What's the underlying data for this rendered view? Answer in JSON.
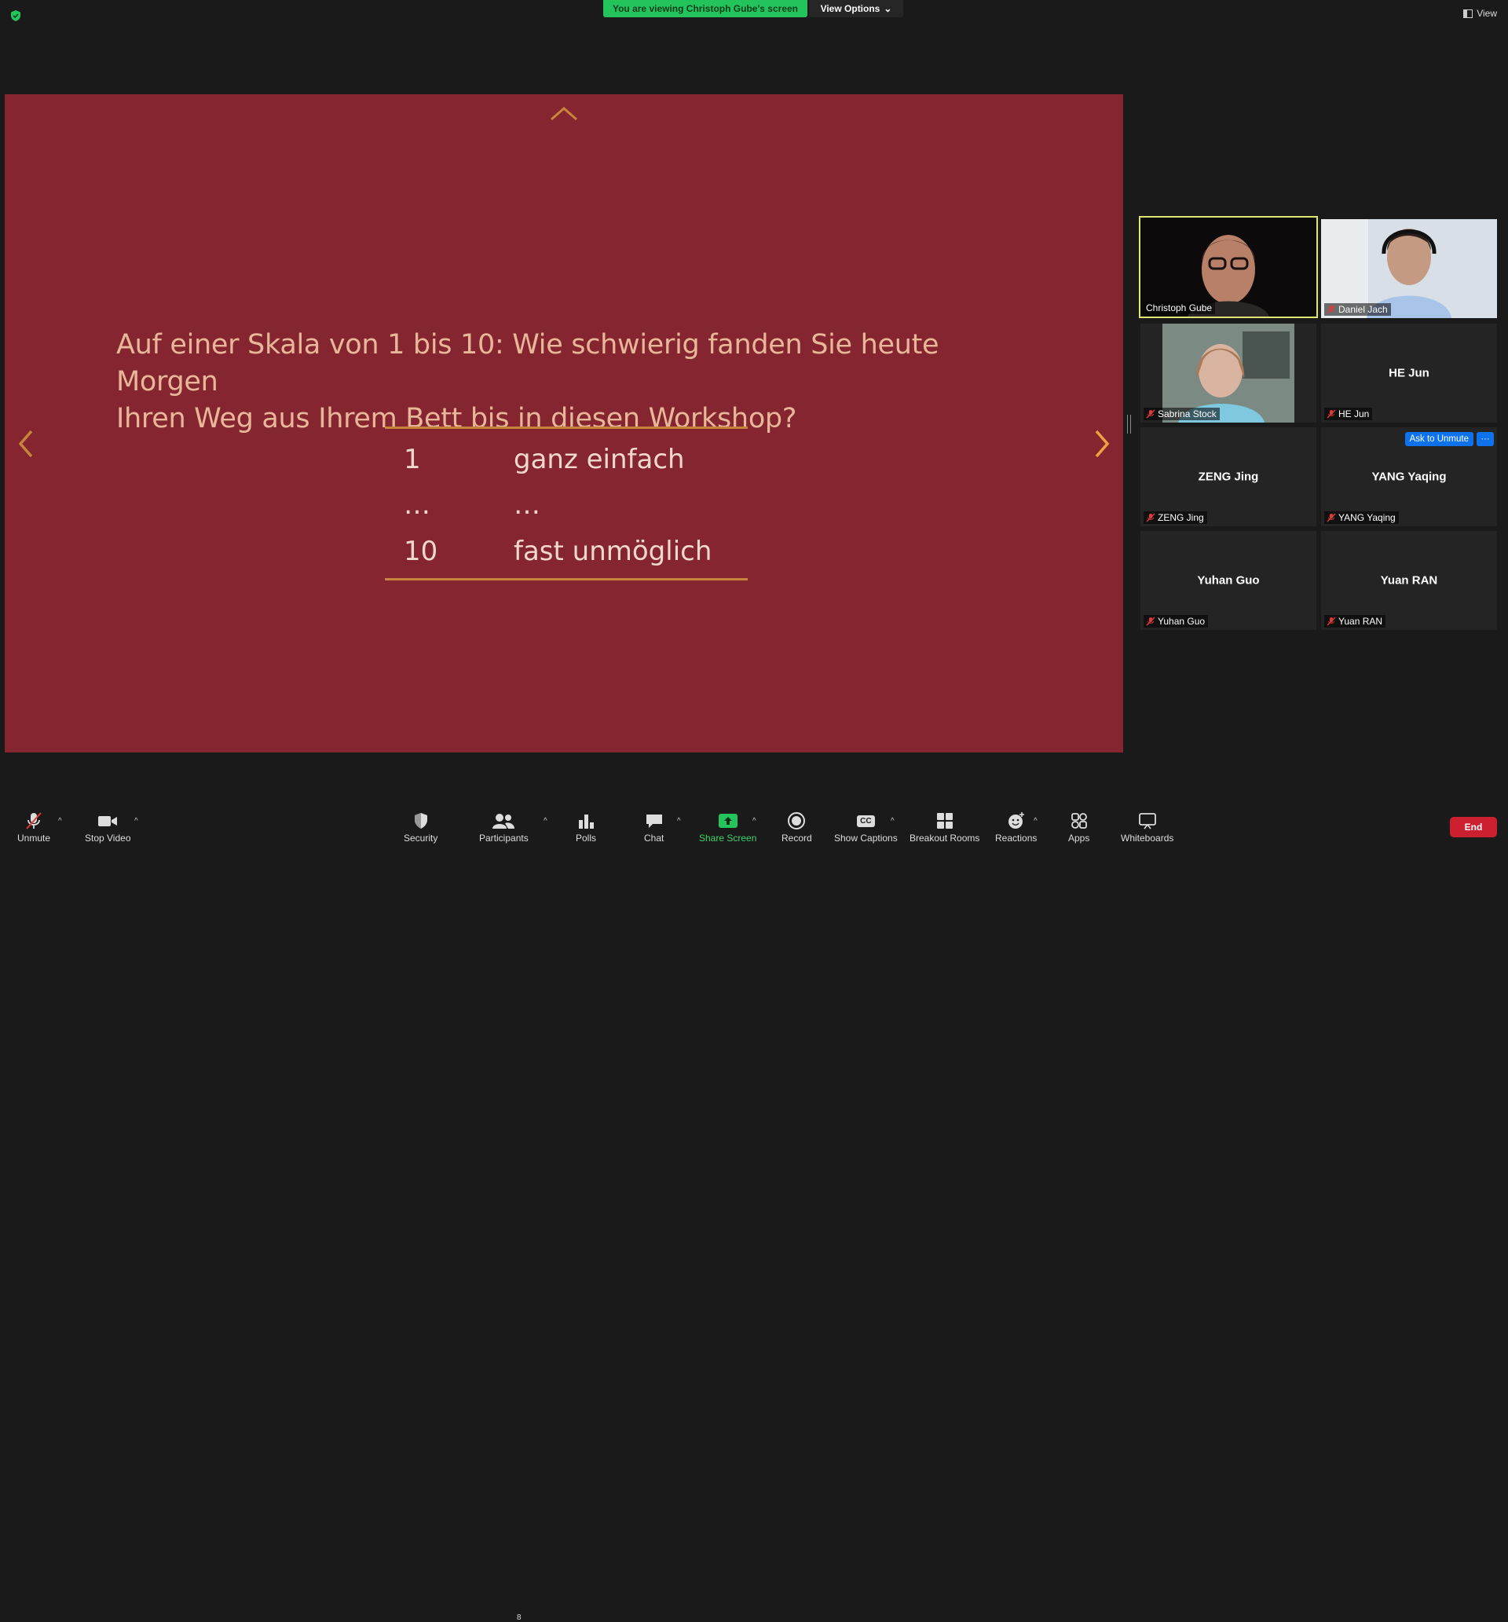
{
  "top": {
    "banner": "You are viewing Christoph Gube's screen",
    "view_options": "View Options",
    "view": "View"
  },
  "slide": {
    "question_line1": "Auf einer Skala von 1 bis 10: Wie schwierig fanden Sie heute Morgen",
    "question_line2": "Ihren Weg aus Ihrem Bett bis in diesen Workshop?",
    "rows": [
      {
        "num": "1",
        "text": "ganz einfach"
      },
      {
        "num": "…",
        "text": "…"
      },
      {
        "num": "10",
        "text": "fast unmöglich"
      }
    ],
    "colors": {
      "background": "#852530",
      "text": "#e8b79a",
      "accent": "#c8833d"
    }
  },
  "participants": [
    {
      "name": "Christoph Gube",
      "active": true,
      "video": true
    },
    {
      "name": "Daniel Jach",
      "video": true,
      "muted": true
    },
    {
      "name": "Sabrina Stock",
      "video": true,
      "muted": true
    },
    {
      "name": "HE Jun",
      "video": false,
      "muted": true
    },
    {
      "name": "ZENG Jing",
      "video": false,
      "muted": true
    },
    {
      "name": "YANG Yaqing",
      "video": false,
      "muted": true,
      "ask_unmute": "Ask to Unmute",
      "more": "···"
    },
    {
      "name": "Yuhan Guo",
      "video": false,
      "muted": true
    },
    {
      "name": "Yuan RAN",
      "video": false,
      "muted": true
    }
  ],
  "toolbar": {
    "unmute": "Unmute",
    "stop_video": "Stop Video",
    "security": "Security",
    "participants": "Participants",
    "participants_count": "8",
    "polls": "Polls",
    "chat": "Chat",
    "share_screen": "Share Screen",
    "record": "Record",
    "show_captions": "Show Captions",
    "captions_icon": "CC",
    "breakout_rooms": "Breakout Rooms",
    "reactions": "Reactions",
    "apps": "Apps",
    "whiteboards": "Whiteboards",
    "end": "End"
  }
}
